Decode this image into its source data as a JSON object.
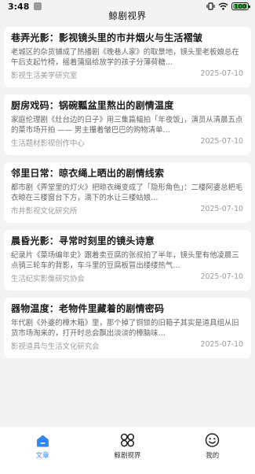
{
  "status_bar": {
    "time": "3:48",
    "battery": "100"
  },
  "nav": {
    "title": "鲸剧视界"
  },
  "articles": [
    {
      "title": "巷弄光影：影视镜头里的市井烟火与生活褶皱",
      "summary": "老城区的杂货铺成了热播剧《晚巷人家》的取景地，镜头里老板娘总在午后支起竹椅，摇着蒲扇给放学的孩子分薄荷糖…",
      "source": "影视生活美学研究室",
      "date": "2025-07-10"
    },
    {
      "title": "厨房戏码：锅碗瓢盆里熬出的剧情温度",
      "summary": "家庭伦理剧《灶台边的日子》用三集篇幅拍「年夜饭」，演员从清晨五点的菜市场开拍 —— 男主攥着皱巴巴的购物清单…",
      "source": "生活题材影视创作中心",
      "date": "2025-07-10"
    },
    {
      "title": "邻里日常：晾衣绳上晒出的剧情线索",
      "summary": "都市剧《弄堂里的灯火》把晾衣绳变成了「隐形角色」：二楼阿婆总把毛衣晾在三楼窗台下方，滴下的水让三楼姑娘…",
      "source": "市井影视文化研究所",
      "date": "2025-07-10"
    },
    {
      "title": "晨昏光影：寻常时刻里的镜头诗意",
      "summary": "纪录片《菜场编年史》跟着卖豆腐的张叔拍了半年，镜头里有他凌晨三点骑三轮车的背影，车斗里的豆腐板冒出缕缕热气…",
      "source": "生活纪实影像研究协会",
      "date": "2025-07-10"
    },
    {
      "title": "器物温度：老物件里藏着的剧情密码",
      "summary": "年代剧《外婆的樟木箱》里，那个掉了铜锁的旧箱子其实是道具组从旧货市场淘来的，打开时总会飘出淡淡的樟脑味…",
      "source": "影视道具与生活文化研究会",
      "date": "2025-07-10"
    }
  ],
  "tabs": [
    {
      "label": "文章",
      "icon": "home-icon",
      "active": true
    },
    {
      "label": "鲸剧视界",
      "icon": "clover-grid-icon",
      "active": false
    },
    {
      "label": "我的",
      "icon": "smiley-face-icon",
      "active": false
    }
  ],
  "colors": {
    "accent": "#2f86ff",
    "background": "#f3f3f3",
    "card": "#ffffff"
  }
}
